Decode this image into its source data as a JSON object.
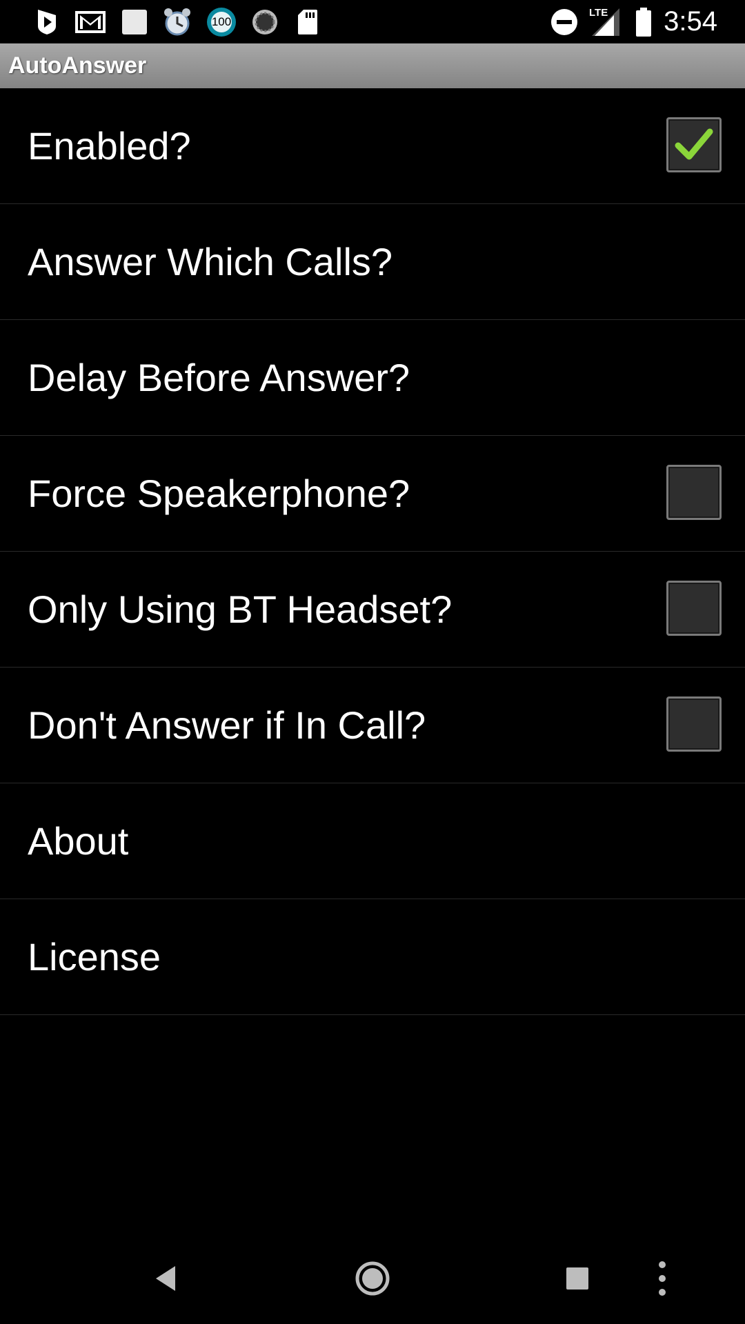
{
  "status_bar": {
    "time": "3:54",
    "battery_badge": "100",
    "network_label": "LTE",
    "icons": [
      "play-store-icon",
      "gmail-icon",
      "square-icon",
      "alarm-icon",
      "battery-badge-icon",
      "loading-icon",
      "sd-card-icon",
      "do-not-disturb-icon",
      "signal-icon",
      "battery-icon"
    ]
  },
  "title_bar": {
    "title": "AutoAnswer"
  },
  "preferences": [
    {
      "label": "Enabled?",
      "has_checkbox": true,
      "checked": true
    },
    {
      "label": "Answer Which Calls?",
      "has_checkbox": false
    },
    {
      "label": "Delay Before Answer?",
      "has_checkbox": false
    },
    {
      "label": "Force Speakerphone?",
      "has_checkbox": true,
      "checked": false
    },
    {
      "label": "Only Using BT Headset?",
      "has_checkbox": true,
      "checked": false
    },
    {
      "label": "Don't Answer if In Call?",
      "has_checkbox": true,
      "checked": false
    },
    {
      "label": "About",
      "has_checkbox": false
    },
    {
      "label": "License",
      "has_checkbox": false
    }
  ],
  "nav_bar": {
    "buttons": [
      "back-icon",
      "home-icon",
      "recents-icon",
      "overflow-menu-icon"
    ]
  },
  "colors": {
    "check_green": "#8bd63a",
    "title_bar_top": "#a8a8a8",
    "title_bar_bottom": "#848484"
  }
}
